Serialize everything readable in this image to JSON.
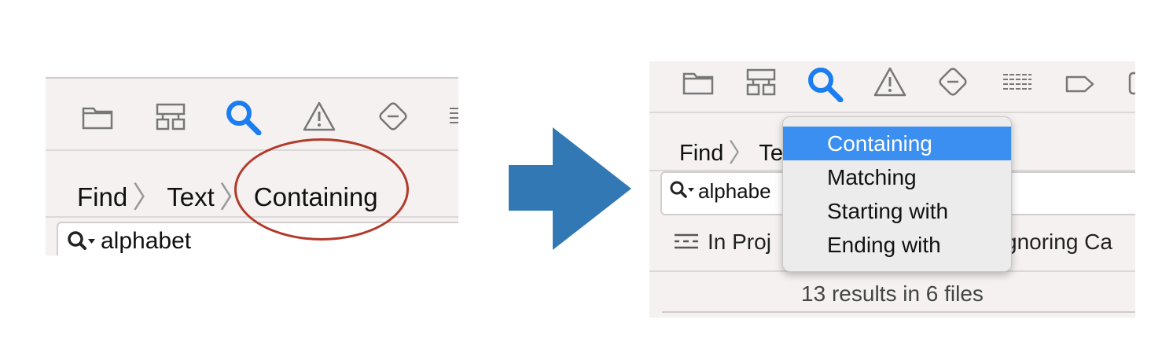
{
  "colors": {
    "accent_blue": "#1a7ef2",
    "highlight_ellipse": "#b23a2a",
    "arrow": "#3278b4",
    "menu_selection": "#3b8ff1"
  },
  "left": {
    "toolbar_icons": [
      "folder-icon",
      "hierarchy-icon",
      "search-icon",
      "warning-icon",
      "diamond-minus-icon",
      "list-icon"
    ],
    "breadcrumb": [
      "Find",
      "Text",
      "Containing"
    ],
    "search_value": "alphabet"
  },
  "right": {
    "toolbar_icons": [
      "folder-icon",
      "hierarchy-icon",
      "search-icon",
      "warning-icon",
      "diamond-minus-icon",
      "list-icon",
      "tag-icon",
      "bubble-icon"
    ],
    "breadcrumb": [
      "Find",
      "Te"
    ],
    "search_value": "alphabe",
    "scope_label": "In Proj",
    "case_label": "gnoring Ca",
    "results": "13 results in 6 files",
    "menu": {
      "items": [
        "Containing",
        "Matching",
        "Starting with",
        "Ending with"
      ],
      "selected": "Containing"
    }
  }
}
